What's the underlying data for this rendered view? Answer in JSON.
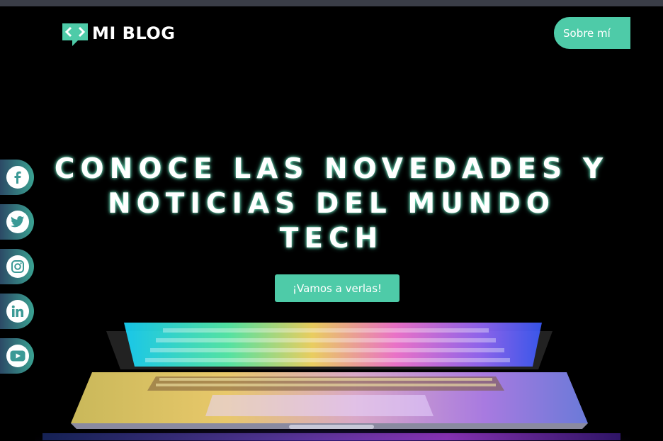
{
  "header": {
    "logo_text": "MI BLOG",
    "logo_icon": "code-brackets-speech-icon",
    "about_label": "Sobre mí"
  },
  "hero": {
    "headline_line1": "Conoce las novedades y",
    "headline_line2": "noticias del mundo",
    "headline_line3": "tech",
    "cta_label": "¡Vamos a verlas!"
  },
  "social": [
    {
      "name": "facebook",
      "icon": "facebook-icon"
    },
    {
      "name": "twitter",
      "icon": "twitter-icon"
    },
    {
      "name": "instagram",
      "icon": "instagram-icon"
    },
    {
      "name": "linkedin",
      "icon": "linkedin-icon"
    },
    {
      "name": "youtube",
      "icon": "youtube-icon"
    }
  ],
  "colors": {
    "accent": "#4ecba8",
    "background": "#000000",
    "topbar": "#3a3d47"
  }
}
